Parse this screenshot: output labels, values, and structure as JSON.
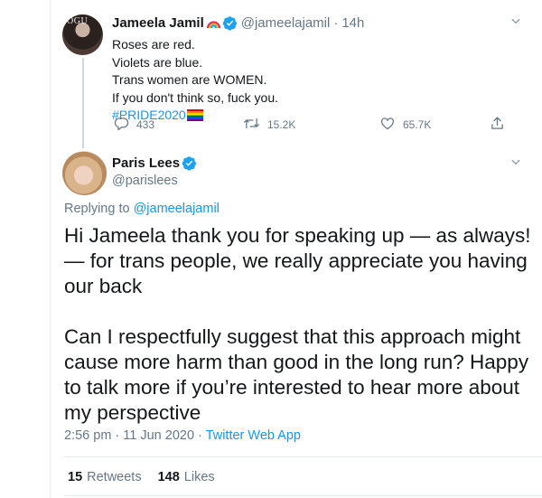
{
  "parent_tweet": {
    "display_name": "Jameela Jamil",
    "handle": "@jameelajamil",
    "separator": "·",
    "time": "14h",
    "avatar_text": "OGU",
    "lines": [
      "Roses are red.",
      "Violets are blue.",
      "Trans women are WOMEN.",
      "If you don't think so, fuck you."
    ],
    "hashtag": "#PRIDE2020",
    "reply_count": "433",
    "retweet_count": "15.2K",
    "like_count": "65.7K"
  },
  "main_tweet": {
    "display_name": "Paris Lees",
    "handle": "@parislees",
    "replying_prefix": "Replying to",
    "replying_to": "@jameelajamil",
    "paragraphs": [
      "Hi Jameela thank you for speaking up — as always! — for trans people, we really appreciate you having our back",
      "Can I respectfully suggest that this approach might cause more harm than good in the long run? Happy to talk more if you’re interested to hear more about my perspective"
    ],
    "timestamp": "2:56 pm · 11 Jun 2020 ·",
    "source": "Twitter Web App",
    "retweets_count": "15",
    "retweets_label": "Retweets",
    "likes_count": "148",
    "likes_label": "Likes"
  },
  "colors": {
    "link": "#1b95e0",
    "secondary_text": "#657786",
    "verified": "#1da1f2",
    "border": "#e6ecf0"
  },
  "icons": [
    "caret-down-icon",
    "verified-badge-icon",
    "rainbow-emoji-icon",
    "pride-flag-emoji-icon",
    "reply-icon",
    "retweet-icon",
    "like-icon",
    "share-icon"
  ]
}
